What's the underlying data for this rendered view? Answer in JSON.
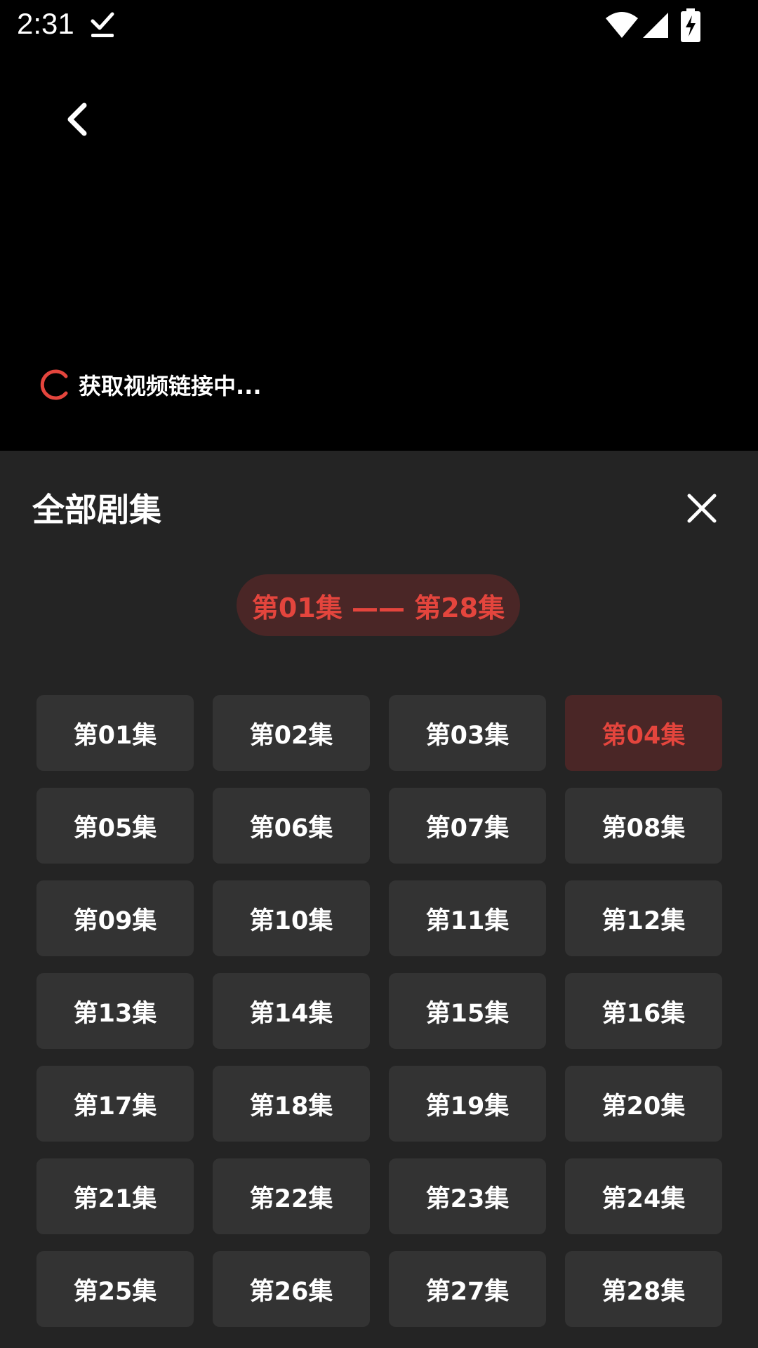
{
  "status_bar": {
    "time": "2:31",
    "icons": [
      "download-done-icon",
      "wifi-icon",
      "cell-signal-icon",
      "battery-charging-icon"
    ]
  },
  "player": {
    "back_icon": "chevron-left-icon",
    "loading_text": "获取视频链接中...",
    "spinner_color": "#e4453d"
  },
  "episodes_panel": {
    "title": "全部剧集",
    "close_icon": "close-icon",
    "range_label": "第01集 —— 第28集",
    "active_episode": "第04集",
    "accent_color": "#e4453d",
    "episodes": [
      "第01集",
      "第02集",
      "第03集",
      "第04集",
      "第05集",
      "第06集",
      "第07集",
      "第08集",
      "第09集",
      "第10集",
      "第11集",
      "第12集",
      "第13集",
      "第14集",
      "第15集",
      "第16集",
      "第17集",
      "第18集",
      "第19集",
      "第20集",
      "第21集",
      "第22集",
      "第23集",
      "第24集",
      "第25集",
      "第26集",
      "第27集",
      "第28集"
    ]
  }
}
